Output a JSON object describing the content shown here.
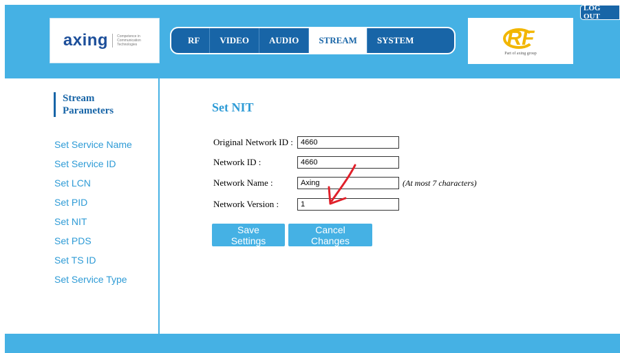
{
  "header": {
    "logo": {
      "word": "axing",
      "tagline": "Competence in Communication Technologies"
    },
    "nav": [
      {
        "label": "RF",
        "active": false
      },
      {
        "label": "VIDEO",
        "active": false
      },
      {
        "label": "AUDIO",
        "active": false
      },
      {
        "label": "STREAM",
        "active": true
      },
      {
        "label": "SYSTEM",
        "active": false
      }
    ],
    "partner_logo": {
      "mark": "RF",
      "caption": "Part of axing group"
    },
    "logout_label": "LOG OUT"
  },
  "sidebar": {
    "title": "Stream Parameters",
    "links": [
      "Set Service Name",
      "Set Service ID",
      "Set LCN",
      "Set PID",
      "Set NIT",
      "Set PDS",
      "Set TS ID",
      "Set Service Type"
    ]
  },
  "main": {
    "title": "Set NIT",
    "fields": {
      "original_network_id": {
        "label": "Original Network ID :",
        "value": "4660"
      },
      "network_id": {
        "label": "Network ID :",
        "value": "4660"
      },
      "network_name": {
        "label": "Network Name :",
        "value": "Axing",
        "hint": "(At most 7 characters)"
      },
      "network_version": {
        "label": "Network Version :",
        "value": "1"
      }
    },
    "buttons": {
      "save": "Save Settings",
      "cancel": "Cancel Changes"
    }
  },
  "colors": {
    "header": "#45b1e4",
    "nav": "#1865a7",
    "link": "#2e9bd6",
    "annotation": "#e0202a"
  },
  "icons": {
    "annotation_arrow": "red-arrow-icon"
  }
}
